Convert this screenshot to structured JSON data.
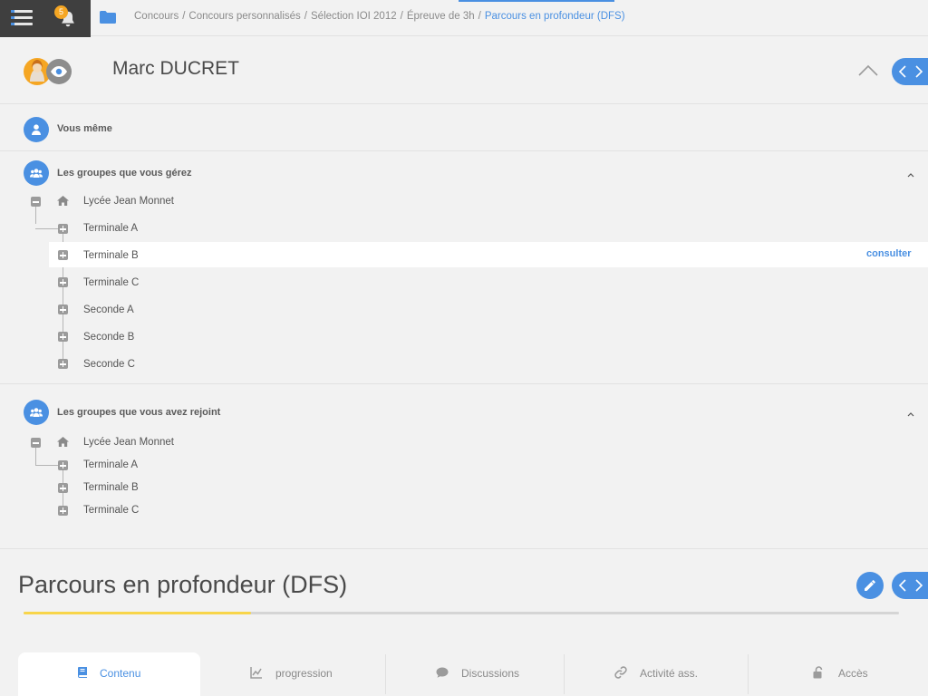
{
  "topbar": {
    "notification_count": "5",
    "breadcrumbs": [
      "Concours",
      "Concours personnalisés",
      "Sélection IOI 2012",
      "Épreuve de 3h"
    ],
    "breadcrumb_separator": "/",
    "breadcrumb_current": "Parcours en profondeur (DFS)"
  },
  "user": {
    "name": "Marc DUCRET"
  },
  "sections": {
    "self": {
      "title": "Vous même"
    },
    "managed": {
      "title": "Les groupes que vous gérez",
      "root": "Lycée Jean Monnet",
      "children": [
        "Terminale A",
        "Terminale B",
        "Terminale C",
        "Seconde A",
        "Seconde B",
        "Seconde C"
      ],
      "action_label": "consulter"
    },
    "joined": {
      "title": "Les groupes que vous avez rejoint",
      "root": "Lycée Jean Monnet",
      "children": [
        "Terminale A",
        "Terminale B",
        "Terminale C"
      ]
    }
  },
  "activity": {
    "title": "Parcours en profondeur (DFS)",
    "progress_fraction": 0.26
  },
  "tabs": [
    {
      "label": "Contenu",
      "icon": "book-icon",
      "active": true
    },
    {
      "label": "progression",
      "icon": "chart-icon",
      "active": false
    },
    {
      "label": "Discussions",
      "icon": "comment-icon",
      "active": false
    },
    {
      "label": "Activité ass.",
      "icon": "link-icon",
      "active": false
    },
    {
      "label": "Accès",
      "icon": "unlock-icon",
      "active": false
    }
  ],
  "colors": {
    "accent": "#4a90e2",
    "topbar_dark": "#3f3f3f",
    "badge": "#f5a623",
    "progress": "#f8d54a"
  }
}
